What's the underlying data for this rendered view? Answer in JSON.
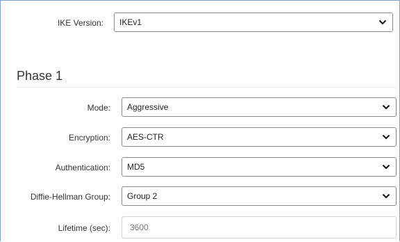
{
  "ike": {
    "label": "IKE Version:",
    "value": "IKEv1"
  },
  "phase1": {
    "title": "Phase 1",
    "mode": {
      "label": "Mode:",
      "value": "Aggressive"
    },
    "encryption": {
      "label": "Encryption:",
      "value": "AES-CTR"
    },
    "authentication": {
      "label": "Authentication:",
      "value": "MD5"
    },
    "dh_group": {
      "label": "Diffie-Hellman Group:",
      "value": "Group 2"
    },
    "lifetime": {
      "label": "Lifetime (sec):",
      "placeholder": "3600"
    }
  },
  "icons": {
    "dropdown": "chevron-down-icon"
  }
}
